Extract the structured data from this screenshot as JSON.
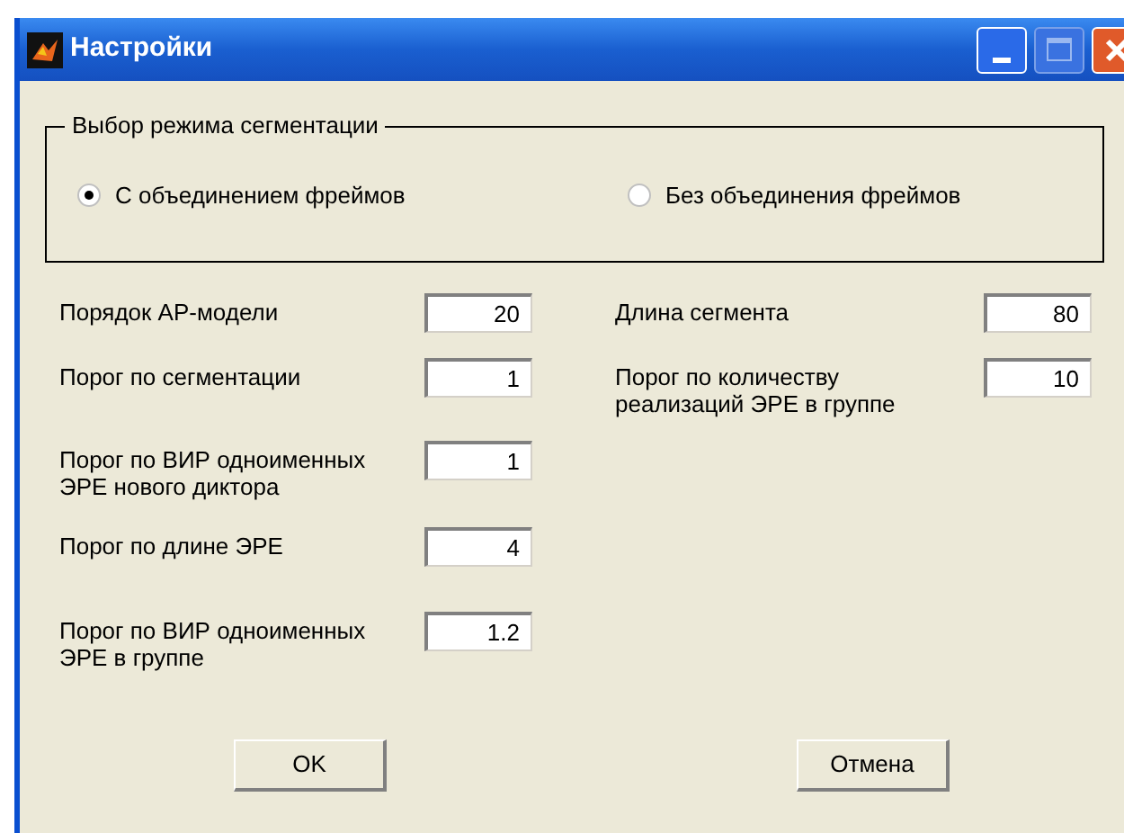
{
  "window": {
    "title": "Настройки"
  },
  "mode_group": {
    "title": "Выбор режима сегментации",
    "options": [
      {
        "label": "С объединением фреймов",
        "selected": true
      },
      {
        "label": "Без объединения фреймов",
        "selected": false
      }
    ]
  },
  "left_fields": [
    {
      "label": "Порядок АР-модели",
      "value": "20"
    },
    {
      "label": "Порог по сегментации",
      "value": "1"
    },
    {
      "label": "Порог по ВИР одноименных\nЭРЕ нового диктора",
      "value": "1"
    },
    {
      "label": "Порог по длине ЭРЕ",
      "value": "4"
    },
    {
      "label": "Порог по ВИР одноименных\nЭРЕ в группе",
      "value": "1.2"
    }
  ],
  "right_fields": [
    {
      "label": "Длина сегмента",
      "value": "80"
    },
    {
      "label": "Порог по количеству\nреализаций ЭРЕ в группе",
      "value": "10"
    }
  ],
  "buttons": [
    "OK",
    "Отмена"
  ]
}
